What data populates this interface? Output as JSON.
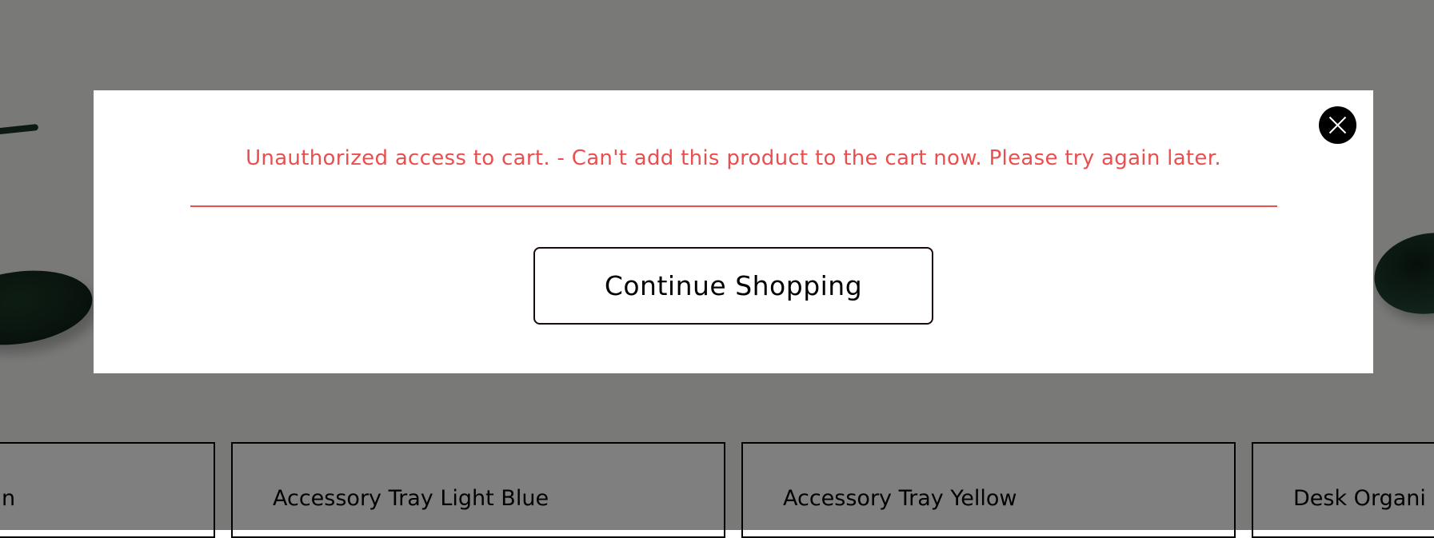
{
  "modal": {
    "error_message": "Unauthorized access to cart. - Can't add this product to the cart now. Please try again later.",
    "continue_label": "Continue Shopping",
    "close_icon": "close-icon"
  },
  "products": [
    {
      "title": "n"
    },
    {
      "title": "Accessory Tray Light Blue"
    },
    {
      "title": "Accessory Tray Yellow"
    },
    {
      "title": "Desk Organi"
    }
  ],
  "colors": {
    "error": "#e94f4f",
    "overlay": "rgba(0,0,0,0.5)",
    "close_button_bg": "#000000",
    "tray_green": "#1c3a28"
  }
}
